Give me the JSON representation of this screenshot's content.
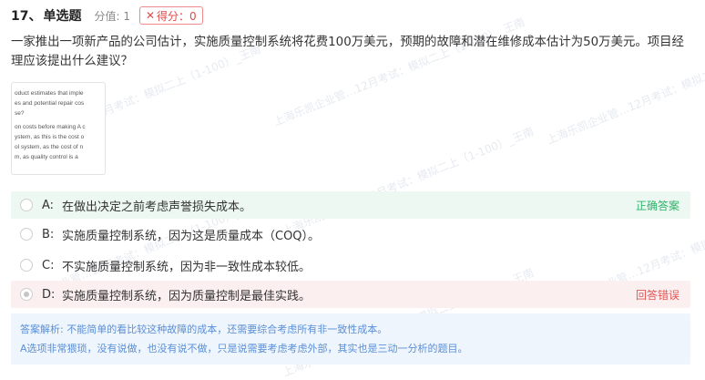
{
  "question": {
    "number": "17、",
    "type": "单选题",
    "points": "分值: 1",
    "score": "得分：0",
    "stem": "一家推出一项新产品的公司估计，实施质量控制系统将花费100万美元，预期的故障和潜在维修成本估计为50万美元。项目经理应该提出什么建议？"
  },
  "image_thumbnail": {
    "lines": [
      "oduct estimates that imple",
      "es and potential repair cos",
      "se?",
      "on costs before making A c",
      "ystem, as this is the cost o",
      "ol system, as the cost of n",
      "m, as quality control is a"
    ]
  },
  "options": [
    {
      "letter": "A:",
      "text": "在做出决定之前考虑声誉损失成本。",
      "tag": "正确答案",
      "state": "correct"
    },
    {
      "letter": "B:",
      "text": "实施质量控制系统，因为这是质量成本（COQ）。",
      "tag": "",
      "state": "none"
    },
    {
      "letter": "C:",
      "text": "不实施质量控制系统，因为非一致性成本较低。",
      "tag": "",
      "state": "none"
    },
    {
      "letter": "D:",
      "text": "实施质量控制系统，因为质量控制是最佳实践。",
      "tag": "回答错误",
      "state": "wrong"
    }
  ],
  "analysis": {
    "line1": "答案解析:   不能简单的看比较这种故障的成本，还需要综合考虑所有非一致性成本。",
    "line2": "A选项非常猥琐，没有说做，也没有说不做，只是说需要考虑考虑外部，其实也是三动一分析的题目。"
  },
  "watermark": {
    "text1": "上海乐凯企业管…12月考试：模拟二上（1-100）_王南",
    "text2": "南"
  },
  "colors": {
    "correct_bg": "#ecf8f1",
    "wrong_bg": "#fcefef",
    "correct_text": "#2fb36b",
    "wrong_text": "#e05757",
    "analysis_bg": "#eef5fd",
    "analysis_text": "#5b8fd6"
  }
}
